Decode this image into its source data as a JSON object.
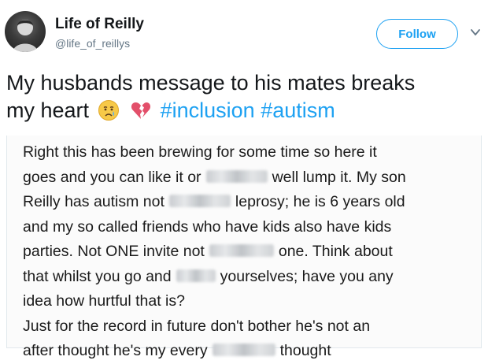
{
  "header": {
    "display_name": "Life of Reilly",
    "handle": "@life_of_reillys",
    "follow_label": "Follow"
  },
  "tweet": {
    "text_line1": "My husbands message to his mates  breaks",
    "text_line2_start": "my heart",
    "emojis": [
      "crying-face-icon",
      "broken-heart-icon"
    ],
    "hashtags": [
      "#inclusion",
      "#autism"
    ]
  },
  "message": {
    "lines": [
      [
        "Right this has been brewing for some time so here it"
      ],
      [
        "goes and you can like it or",
        "well lump it. My son"
      ],
      [
        "Reilly has autism not",
        "leprosy; he is 6 years old"
      ],
      [
        "and my so called friends who have kids also have kids"
      ],
      [
        "parties. Not ONE invite not",
        "one. Think about"
      ],
      [
        "that whilst you go and",
        "yourselves; have you any"
      ],
      [
        "idea how hurtful that is?"
      ],
      [
        "Just for the record in future don't bother he's not an"
      ],
      [
        "after thought he's my every",
        "thought"
      ]
    ]
  },
  "colors": {
    "accent": "#1da1f2",
    "text": "#14171a",
    "secondary_text": "#657786"
  }
}
